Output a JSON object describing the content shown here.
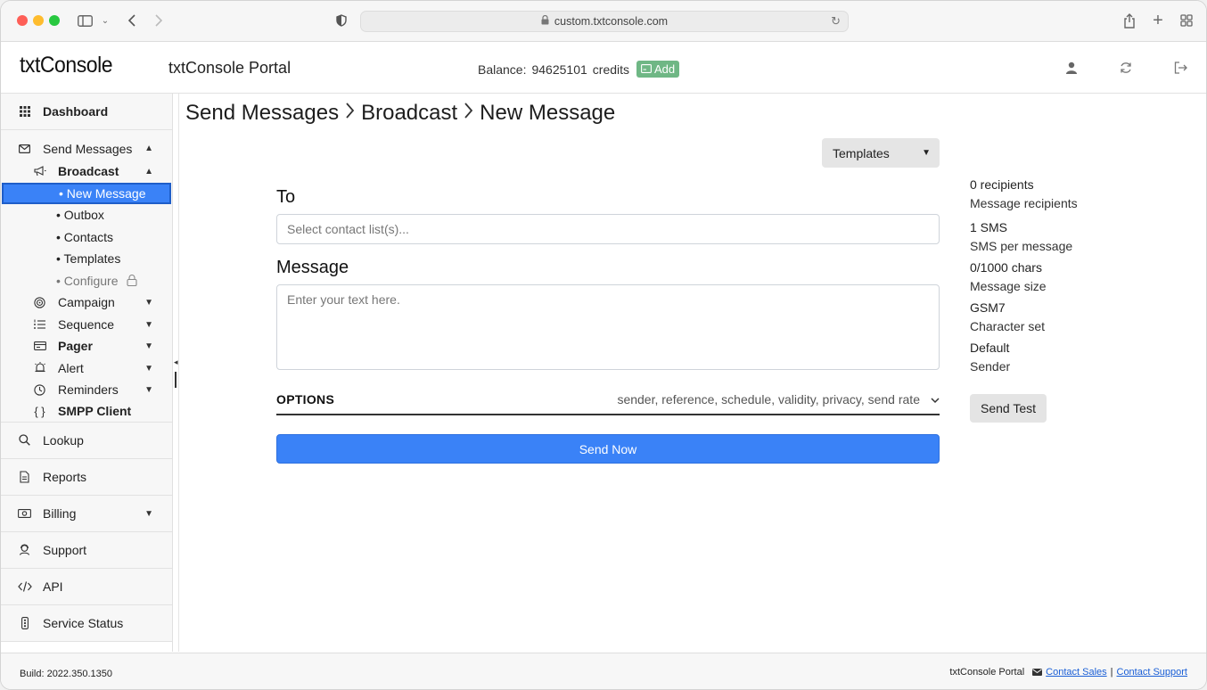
{
  "browser": {
    "url": "custom.txtconsole.com"
  },
  "header": {
    "logo": "txtConsole",
    "portal_title": "txtConsole Portal",
    "balance_label": "Balance:",
    "balance_value": "94625101",
    "balance_unit": "credits",
    "add_label": "Add"
  },
  "sidebar": {
    "dashboard": "Dashboard",
    "send_messages": "Send Messages",
    "broadcast": "Broadcast",
    "broadcast_items": {
      "new_message": "• New Message",
      "outbox": "• Outbox",
      "contacts": "• Contacts",
      "templates": "• Templates",
      "configure": "• Configure"
    },
    "campaign": "Campaign",
    "sequence": "Sequence",
    "pager": "Pager",
    "alert": "Alert",
    "reminders": "Reminders",
    "smpp_client": "SMPP Client",
    "lookup": "Lookup",
    "reports": "Reports",
    "billing": "Billing",
    "support": "Support",
    "api": "API",
    "service_status": "Service Status"
  },
  "breadcrumb": {
    "part1": "Send Messages",
    "part2": "Broadcast",
    "part3": "New Message",
    "sep": ">"
  },
  "form": {
    "templates_label": "Templates",
    "to_label": "To",
    "to_placeholder": "Select contact list(s)...",
    "message_label": "Message",
    "message_placeholder": "Enter your text here.",
    "options_title": "OPTIONS",
    "options_summary": "sender, reference, schedule, validity, privacy, send rate",
    "send_now": "Send Now"
  },
  "stats": {
    "recipients_value": "0 recipients",
    "recipients_label": "Message recipients",
    "sms_value": "1 SMS",
    "sms_label": "SMS per message",
    "chars_value": "0/1000 chars",
    "chars_label": "Message size",
    "charset_value": "GSM7",
    "charset_label": "Character set",
    "sender_value": "Default",
    "sender_label": "Sender",
    "send_test": "Send Test"
  },
  "footer": {
    "build": "Build: 2022.350.1350",
    "portal": "txtConsole Portal",
    "contact_sales": "Contact Sales",
    "divider": "|",
    "contact_support": "Contact Support"
  },
  "colors": {
    "accent": "#3a82f7",
    "add_button": "#6fb785"
  }
}
